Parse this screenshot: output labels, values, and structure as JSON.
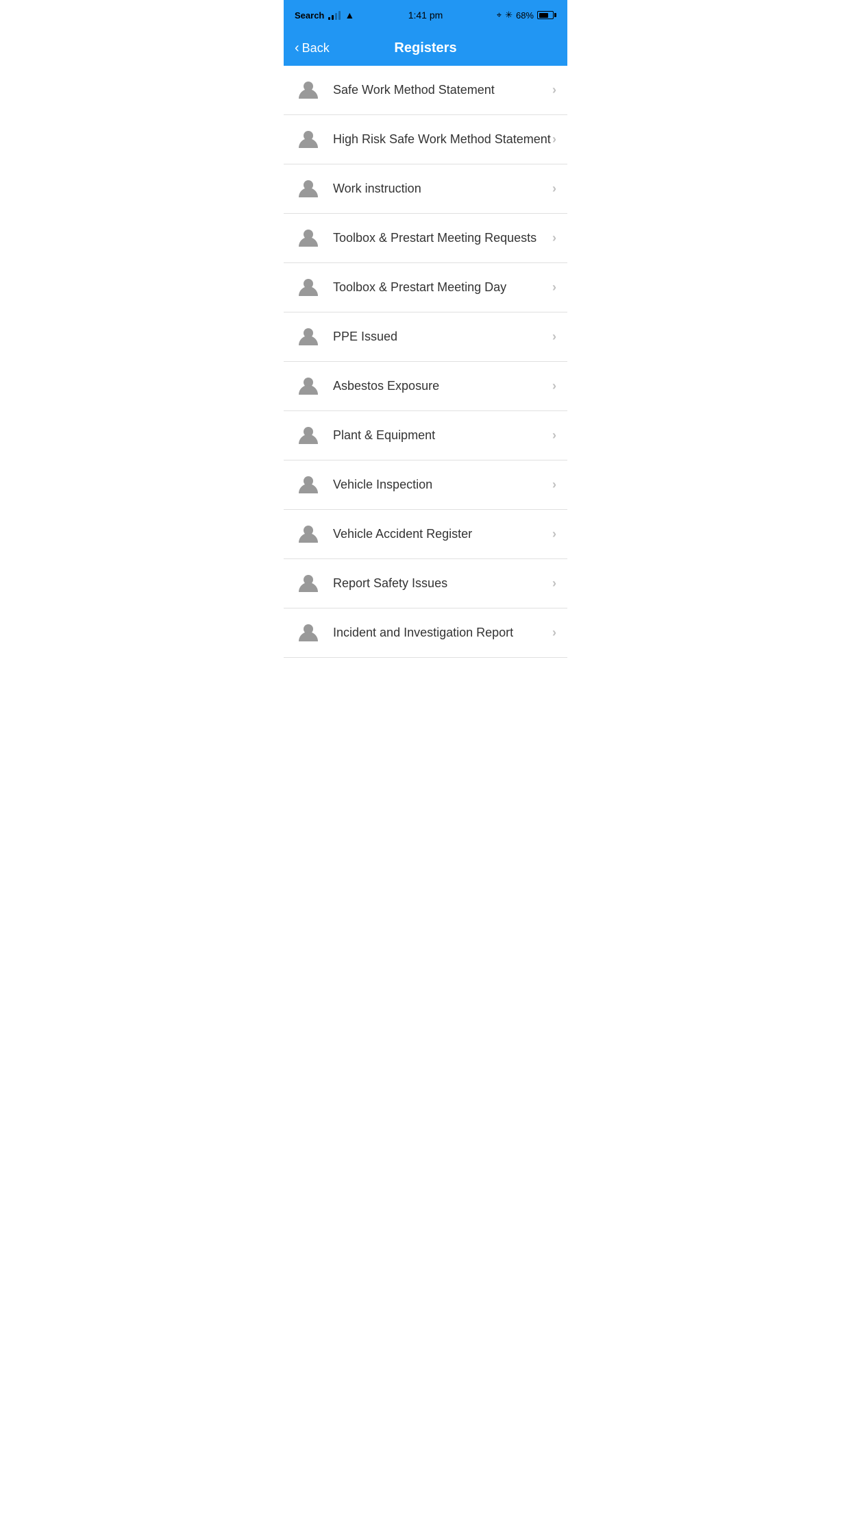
{
  "statusBar": {
    "appName": "Search",
    "time": "1:41 pm",
    "battery": "68%"
  },
  "navBar": {
    "backLabel": "Back",
    "title": "Registers"
  },
  "listItems": [
    {
      "id": 1,
      "label": "Safe Work Method Statement"
    },
    {
      "id": 2,
      "label": "High Risk Safe Work Method Statement"
    },
    {
      "id": 3,
      "label": "Work instruction"
    },
    {
      "id": 4,
      "label": "Toolbox & Prestart Meeting Requests"
    },
    {
      "id": 5,
      "label": "Toolbox & Prestart Meeting Day"
    },
    {
      "id": 6,
      "label": "PPE Issued"
    },
    {
      "id": 7,
      "label": "Asbestos Exposure"
    },
    {
      "id": 8,
      "label": "Plant & Equipment"
    },
    {
      "id": 9,
      "label": "Vehicle Inspection"
    },
    {
      "id": 10,
      "label": "Vehicle Accident Register"
    },
    {
      "id": 11,
      "label": "Report Safety Issues"
    },
    {
      "id": 12,
      "label": "Incident and Investigation Report"
    }
  ],
  "icons": {
    "chevron": "›",
    "back": "‹"
  }
}
